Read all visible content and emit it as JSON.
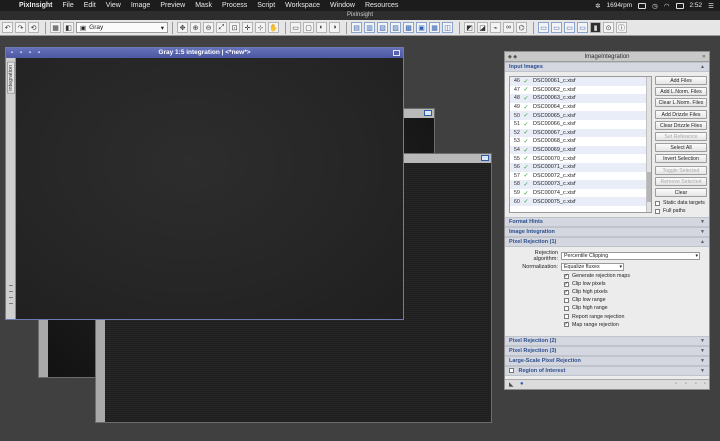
{
  "menubar": {
    "app_name": "PixInsight",
    "items": [
      "File",
      "Edit",
      "View",
      "Image",
      "Preview",
      "Mask",
      "Process",
      "Script",
      "Workspace",
      "Window",
      "Resources"
    ],
    "status": {
      "fan": "1694rpm",
      "time": "2:52"
    }
  },
  "app_title": "PixInsight",
  "toolbar": {
    "colorspace_select": "Gray"
  },
  "image_window": {
    "title": "Gray 1:5 integration | <*new*>",
    "side_tab": "integration"
  },
  "panel": {
    "title": "ImageIntegration",
    "sections": {
      "input_images": "Input Images",
      "format_hints": "Format Hints",
      "image_integration": "Image Integration",
      "pixel_rejection_1": "Pixel Rejection (1)",
      "pixel_rejection_2": "Pixel Rejection (2)",
      "pixel_rejection_3": "Pixel Rejection (3)",
      "large_scale": "Large-Scale Pixel Rejection",
      "region_of_interest": "Region of Interest"
    },
    "files": [
      {
        "n": "46",
        "name": "DSC00061_c.xisf"
      },
      {
        "n": "47",
        "name": "DSC00062_c.xisf"
      },
      {
        "n": "48",
        "name": "DSC00063_c.xisf"
      },
      {
        "n": "49",
        "name": "DSC00064_c.xisf"
      },
      {
        "n": "50",
        "name": "DSC00065_c.xisf"
      },
      {
        "n": "51",
        "name": "DSC00066_c.xisf"
      },
      {
        "n": "52",
        "name": "DSC00067_c.xisf"
      },
      {
        "n": "53",
        "name": "DSC00068_c.xisf"
      },
      {
        "n": "54",
        "name": "DSC00069_c.xisf"
      },
      {
        "n": "55",
        "name": "DSC00070_c.xisf"
      },
      {
        "n": "56",
        "name": "DSC00071_c.xisf"
      },
      {
        "n": "57",
        "name": "DSC00072_c.xisf"
      },
      {
        "n": "58",
        "name": "DSC00073_c.xisf"
      },
      {
        "n": "59",
        "name": "DSC00074_c.xisf"
      },
      {
        "n": "60",
        "name": "DSC00075_c.xisf"
      }
    ],
    "buttons": {
      "add_files": "Add Files",
      "add_lnorm": "Add L.Norm. Files",
      "clear_lnorm": "Clear L.Norm. Files",
      "add_drizzle": "Add Drizzle Files",
      "clear_drizzle": "Clear Drizzle Files",
      "set_reference": "Set Reference",
      "select_all": "Select All",
      "invert_selection": "Invert Selection",
      "toggle_selected": "Toggle Selected",
      "remove_selected": "Remove Selected",
      "clear": "Clear"
    },
    "checks": {
      "static_data_targets": "Static data targets",
      "full_paths": "Full paths"
    },
    "rejection": {
      "algorithm_label": "Rejection algorithm:",
      "algorithm_value": "Percentile Clipping",
      "normalization_label": "Normalization:",
      "normalization_value": "Equalize fluxes",
      "options": [
        {
          "label": "Generate rejection maps",
          "checked": true
        },
        {
          "label": "Clip low pixels",
          "checked": true
        },
        {
          "label": "Clip high pixels",
          "checked": true
        },
        {
          "label": "Clip low range",
          "checked": false
        },
        {
          "label": "Clip high range",
          "checked": false
        },
        {
          "label": "Report range rejection",
          "checked": false
        },
        {
          "label": "Map range rejection",
          "checked": true
        }
      ]
    }
  },
  "colors": {
    "title_active": "#5663ac",
    "section_text": "#2b4e8c",
    "check_green": "#2d9a3a"
  }
}
